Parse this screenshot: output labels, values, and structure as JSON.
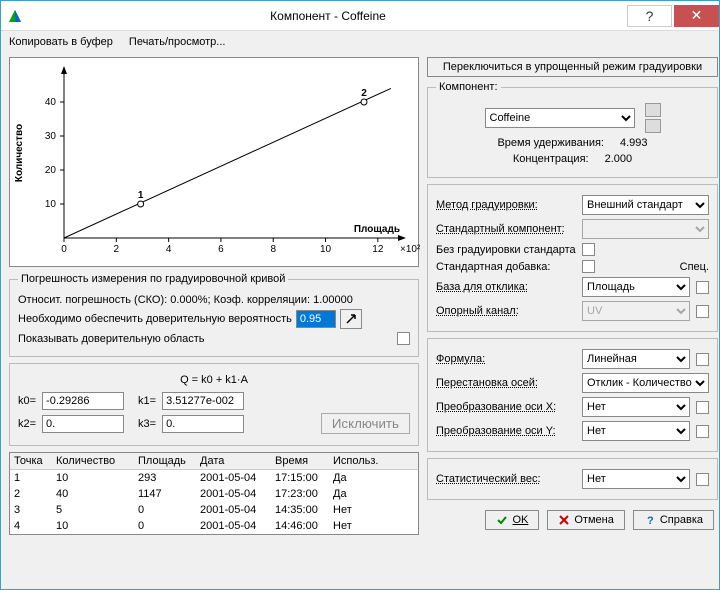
{
  "window": {
    "title": "Компонент - Coffeine"
  },
  "menu": {
    "copy": "Копировать в буфер",
    "print": "Печать/просмотр..."
  },
  "chart_data": {
    "type": "line",
    "title": "",
    "xlabel": "Площадь",
    "ylabel": "Количество",
    "x_multiplier_label": "×10²",
    "xlim": [
      0,
      13
    ],
    "ylim": [
      0,
      50
    ],
    "xticks": [
      0,
      2,
      4,
      6,
      8,
      10,
      12
    ],
    "yticks": [
      10,
      20,
      30,
      40
    ],
    "series": [
      {
        "name": "fit",
        "type": "line",
        "x": [
          0,
          12.5
        ],
        "y": [
          0,
          44
        ]
      },
      {
        "name": "points",
        "type": "scatter",
        "labels": [
          "1",
          "2"
        ],
        "x": [
          2.93,
          11.47
        ],
        "y": [
          10,
          40
        ]
      }
    ]
  },
  "err_group": {
    "legend": "Погрешность измерения по градуировочной кривой",
    "line1": "Относит. погрешность (СКО): 0.000%;  Коэф. корреляции: 1.00000",
    "line2": "Необходимо обеспечить доверительную вероятность",
    "prob": "0.95",
    "show_conf": "Показывать доверительную область"
  },
  "equation": "Q = k0 + k1·A",
  "coefs": {
    "k0_label": "k0=",
    "k0": "-0.29286",
    "k1_label": "k1=",
    "k1": "3.51277e-002",
    "k2_label": "k2=",
    "k2": "0.",
    "k3_label": "k3=",
    "k3": "0."
  },
  "exclude": "Исключить",
  "table": {
    "headers": [
      "Точка",
      "Количество",
      "Площадь",
      "Дата",
      "Время",
      "Использ."
    ],
    "rows": [
      [
        "1",
        "10",
        "293",
        "2001-05-04",
        "17:15:00",
        "Да"
      ],
      [
        "2",
        "40",
        "1147",
        "2001-05-04",
        "17:23:00",
        "Да"
      ],
      [
        "3",
        "5",
        "0",
        "2001-05-04",
        "14:35:00",
        "Нет"
      ],
      [
        "4",
        "10",
        "0",
        "2001-05-04",
        "14:46:00",
        "Нет"
      ]
    ]
  },
  "right": {
    "switch_btn": "Переключиться в упрощенный режим градуировки",
    "component_legend": "Компонент:",
    "component_value": "Coffeine",
    "ret_time_label": "Время удерживания:",
    "ret_time": "4.993",
    "conc_label": "Концентрация:",
    "conc": "2.000",
    "method_label": "Метод градуировки:",
    "method_value": "Внешний стандарт",
    "std_comp_label": "Стандартный компонент:",
    "no_std_cal": "Без градуировки стандарта",
    "std_add": "Стандартная добавка:",
    "spec": "Спец.",
    "base_label": "База для отклика:",
    "base_value": "Площадь",
    "ref_ch_label": "Опорный канал:",
    "ref_ch_value": "UV",
    "formula_label": "Формула:",
    "formula_value": "Линейная",
    "axes_label": "Перестановка осей:",
    "axes_value": "Отклик - Количество",
    "tx_label": "Преобразование оси X:",
    "tx_value": "Нет",
    "ty_label": "Преобразование оси Y:",
    "ty_value": "Нет",
    "weight_label": "Статистический вес:",
    "weight_value": "Нет"
  },
  "buttons": {
    "ok": "OK",
    "cancel": "Отмена",
    "help": "Справка"
  }
}
